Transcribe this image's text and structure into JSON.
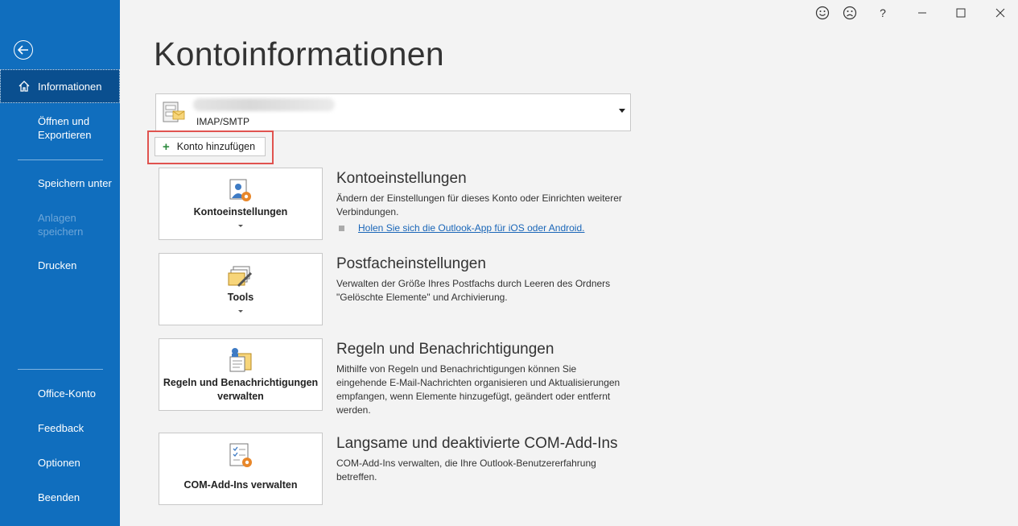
{
  "sidebar": {
    "back_icon": "arrow-left-icon",
    "items": [
      {
        "label": "Informationen",
        "icon": "home-icon"
      },
      {
        "label": "Öffnen und Exportieren"
      },
      {
        "label": "Speichern unter"
      },
      {
        "label": "Anlagen speichern"
      },
      {
        "label": "Drucken"
      },
      {
        "label": "Office-Konto"
      },
      {
        "label": "Feedback"
      },
      {
        "label": "Optionen"
      },
      {
        "label": "Beenden"
      }
    ]
  },
  "titlebar": {
    "icons": [
      "smile-icon",
      "frown-icon",
      "help-icon",
      "minimize-icon",
      "maximize-icon",
      "close-icon"
    ],
    "help_label": "?"
  },
  "page": {
    "title": "Kontoinformationen"
  },
  "account": {
    "type": "IMAP/SMTP",
    "add_label": "Konto hinzufügen",
    "add_icon": "plus-icon"
  },
  "sections": [
    {
      "button_label": "Kontoeinstellungen",
      "icon": "account-settings-icon",
      "title": "Kontoeinstellungen",
      "description": "Ändern der Einstellungen für dieses Konto oder Einrichten weiterer Verbindungen.",
      "link": "Holen Sie sich die Outlook-App für iOS oder Android."
    },
    {
      "button_label": "Tools",
      "icon": "tools-icon",
      "title": "Postfacheinstellungen",
      "description": "Verwalten der Größe Ihres Postfachs durch Leeren des Ordners \"Gelöschte Elemente\" und Archivierung."
    },
    {
      "button_label": "Regeln und Benachrichtigungen verwalten",
      "icon": "rules-icon",
      "title": "Regeln und Benachrichtigungen",
      "description": "Mithilfe von Regeln und Benachrichtigungen können Sie eingehende E-Mail-Nachrichten organisieren und Aktualisierungen empfangen, wenn Elemente hinzugefügt, geändert oder entfernt werden."
    },
    {
      "button_label": "COM-Add-Ins verwalten",
      "icon": "com-addins-icon",
      "title": "Langsame und deaktivierte COM-Add-Ins",
      "description": "COM-Add-Ins verwalten, die Ihre Outlook-Benutzererfahrung betreffen."
    }
  ],
  "colors": {
    "sidebar": "#106ebe",
    "highlight": "#e0534f",
    "link": "#1a66b8"
  }
}
